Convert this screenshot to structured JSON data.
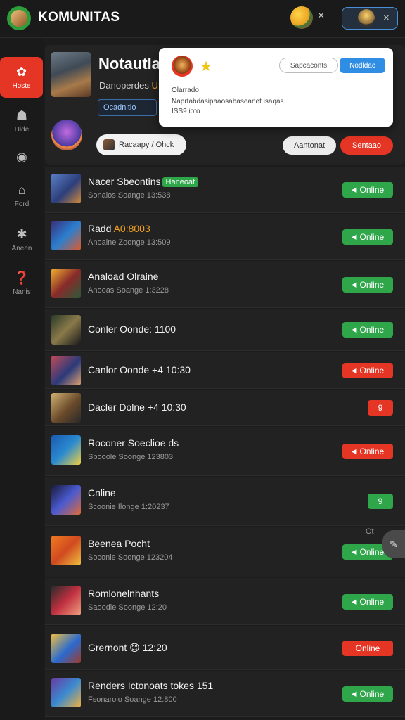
{
  "app": {
    "title": "KOMUNITAS"
  },
  "topbar": {
    "close_glyph": "×",
    "pill_close_glyph": "×"
  },
  "sidebar": {
    "items": [
      {
        "label": "Hoste",
        "icon": "community-icon",
        "glyph": "✿",
        "active": true
      },
      {
        "label": "Hide",
        "icon": "users-icon",
        "glyph": "☗",
        "active": false
      },
      {
        "label": "",
        "icon": "chat-icon",
        "glyph": "◉",
        "active": false
      },
      {
        "label": "Ford",
        "icon": "home-icon",
        "glyph": "⌂",
        "active": false
      },
      {
        "label": "Aneen",
        "icon": "group-icon",
        "glyph": "✱",
        "active": false
      },
      {
        "label": "Nanis",
        "icon": "help-icon",
        "glyph": "❓",
        "active": false
      }
    ]
  },
  "header": {
    "title": "Notautla",
    "subtitle": "Danoperdes ",
    "subtitle_accent": "U",
    "search_chip": "Ocadnitio",
    "user_chip": "Racaapy / Ohck",
    "gray_button": "Aantonat",
    "red_button": "Sentaao"
  },
  "popup": {
    "outline_button": "Sapcaconts",
    "blue_button": "Nodldac",
    "line1": "Olarrado",
    "line2": "Naprtabdasipaaosabaseanet isaqas",
    "line3": "ISS9 ioto"
  },
  "rows": [
    {
      "title": "Nacer Sbeontins",
      "badge": "Haneoat",
      "sub": "Sonaios Soange 13:538",
      "status": "Online",
      "color": "green",
      "has_icon": true
    },
    {
      "title": "Radd ",
      "title_accent": "A0:8003",
      "sub": "Anoaine Zoonge 13:509",
      "status": "Online",
      "color": "green",
      "has_icon": true
    },
    {
      "title": "Anaload Olraine",
      "sub": "Anooas Soange 1:3228",
      "status": "Online",
      "color": "green",
      "has_icon": true
    },
    {
      "title": "Conler Oonde: 1100",
      "sub": "",
      "status": "Online",
      "color": "green",
      "has_icon": true
    },
    {
      "title": "Canlor Oonde +4 10:30",
      "sub": "",
      "status": "Online",
      "color": "red",
      "has_icon": true
    },
    {
      "title": "Dacler Dolne +4 10:30",
      "sub": "",
      "status": "9",
      "color": "red",
      "has_icon": false
    },
    {
      "title": "Roconer Soeclioe ds",
      "sub": "Sbooole Soonge 123803",
      "status": "Online",
      "color": "red",
      "has_icon": true
    },
    {
      "title": "Cnline",
      "sub": "Scoonie Ilonge 1:20237",
      "status": "9",
      "color": "green",
      "has_icon": false
    },
    {
      "title": "Beenea Pocht",
      "sub": "Soconie Soonge 123204",
      "status": "Online",
      "color": "green",
      "has_icon": true
    },
    {
      "title": "Romlonelnhants",
      "sub": "Saoodie Soonge 12:20",
      "status": "Online",
      "color": "green",
      "has_icon": true
    },
    {
      "title": "Grernont 😊 12:20",
      "sub": "",
      "status": "Online",
      "color": "red",
      "has_icon": false
    },
    {
      "title": "Renders Ictonoats tokes 151",
      "sub": "Fsonaroio Soange 12:800",
      "status": "Online",
      "color": "green",
      "has_icon": true
    }
  ],
  "edge_text": "Ot",
  "side_fab_glyph": "✎",
  "colors": {
    "green": "#2fa64a",
    "red": "#e53524",
    "accent": "#f0a020",
    "blue": "#2f8de4"
  }
}
